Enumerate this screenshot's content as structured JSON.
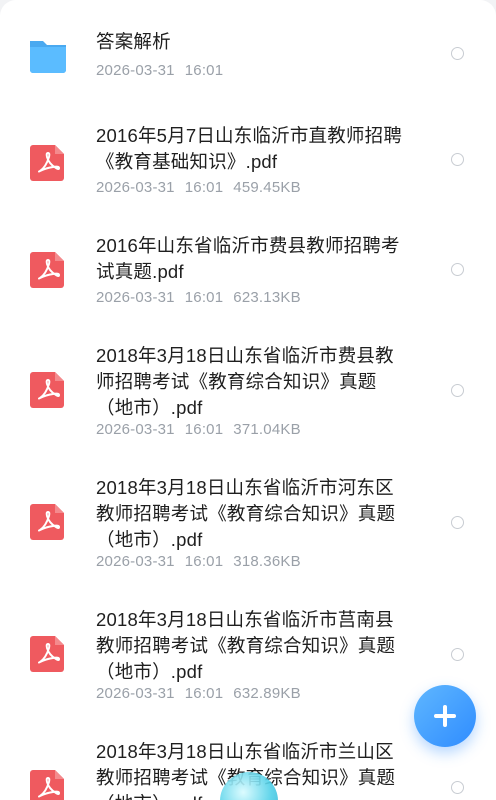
{
  "files": [
    {
      "type": "folder",
      "title_lines": [
        "答案解析"
      ],
      "date": "2026-03-31",
      "time": "16:01",
      "size": ""
    },
    {
      "type": "pdf",
      "title_lines": [
        "2016年5月7日山东临沂市直教师招聘",
        "《教育基础知识》.pdf"
      ],
      "date": "2026-03-31",
      "time": "16:01",
      "size": "459.45KB"
    },
    {
      "type": "pdf",
      "title_lines": [
        "2016年山东省临沂市费县教师招聘考",
        "试真题.pdf"
      ],
      "date": "2026-03-31",
      "time": "16:01",
      "size": "623.13KB"
    },
    {
      "type": "pdf",
      "title_lines": [
        "2018年3月18日山东省临沂市费县教",
        "师招聘考试《教育综合知识》真题",
        "（地市）.pdf"
      ],
      "date": "2026-03-31",
      "time": "16:01",
      "size": "371.04KB"
    },
    {
      "type": "pdf",
      "title_lines": [
        "2018年3月18日山东省临沂市河东区",
        "教师招聘考试《教育综合知识》真题",
        "（地市）.pdf"
      ],
      "date": "2026-03-31",
      "time": "16:01",
      "size": "318.36KB"
    },
    {
      "type": "pdf",
      "title_lines": [
        "2018年3月18日山东省临沂市莒南县",
        "教师招聘考试《教育综合知识》真题",
        "（地市）.pdf"
      ],
      "date": "2026-03-31",
      "time": "16:01",
      "size": "632.89KB"
    },
    {
      "type": "pdf",
      "title_lines": [
        "2018年3月18日山东省临沂市兰山区",
        "教师招聘考试《教育综合知识》真题",
        "（地市）.pdf"
      ],
      "date": "",
      "time": "",
      "size": ""
    }
  ],
  "icons": {
    "folder_color": "#52b4ff",
    "pdf_color": "#ef5a5f"
  },
  "fab": {
    "icon": "plus-icon"
  }
}
